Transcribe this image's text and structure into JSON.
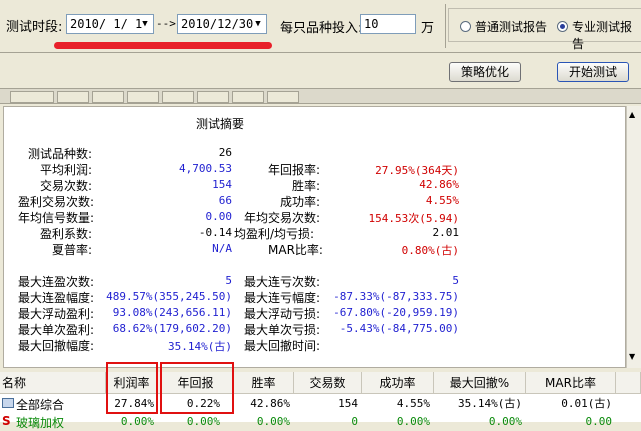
{
  "toolbar": {
    "period_label": "测试时段:",
    "start_date": "2010/ 1/ 1",
    "arrow": "-->",
    "end_date": "2010/12/30",
    "invest_label": "每只品种投入:",
    "invest_value": "10",
    "invest_unit": "万",
    "radio_normal": "普通测试报告",
    "radio_pro": "专业测试报告",
    "optimize_button": "策略优化",
    "start_button": "开始测试"
  },
  "summary": {
    "title": "测试摘要",
    "left_rows": [
      {
        "label": "测试品种数:",
        "value": "26"
      },
      {
        "label": "平均利润:",
        "value": "4,700.53"
      },
      {
        "label": "交易次数:",
        "value": "154"
      },
      {
        "label": "盈利交易次数:",
        "value": "66"
      },
      {
        "label": "年均信号数量:",
        "value": "0.00"
      },
      {
        "label": "盈利系数:",
        "value": "-0.14"
      },
      {
        "label": "夏普率:",
        "value": "N/A"
      }
    ],
    "right_rows": [
      {
        "label": "年回报率:",
        "value": "27.95%(364天)"
      },
      {
        "label": "胜率:",
        "value": "42.86%"
      },
      {
        "label": "成功率:",
        "value": "4.55%"
      },
      {
        "label": "年均交易次数:",
        "value": "154.53次(5.94)"
      },
      {
        "label": "均盈利/均亏损:",
        "value": "2.01"
      },
      {
        "label": "MAR比率:",
        "value": "0.80%(古)"
      }
    ],
    "left_rows2": [
      {
        "label": "最大连盈次数:",
        "value": "5"
      },
      {
        "label": "最大连盈幅度:",
        "value": "489.57%(355,245.50)"
      },
      {
        "label": "最大浮动盈利:",
        "value": "93.08%(243,656.11)"
      },
      {
        "label": "最大单次盈利:",
        "value": "68.62%(179,602.20)"
      },
      {
        "label": "最大回撤幅度:",
        "value": "35.14%(古)"
      }
    ],
    "right_rows2": [
      {
        "label": "最大连亏次数:",
        "value": "5"
      },
      {
        "label": "最大连亏幅度:",
        "value": "-87.33%(-87,333.75)"
      },
      {
        "label": "最大浮动亏损:",
        "value": "-67.80%(-20,959.19)"
      },
      {
        "label": "最大单次亏损:",
        "value": "-5.43%(-84,775.00)"
      },
      {
        "label": "最大回撤时间:",
        "value": ""
      }
    ]
  },
  "grid": {
    "headers": [
      "名称",
      "利润率",
      "年回报",
      "胜率",
      "交易数",
      "成功率",
      "最大回撤%",
      "MAR比率"
    ],
    "rows": [
      {
        "name": "全部综合",
        "values": [
          "27.84%",
          "0.22%",
          "42.86%",
          "154",
          "4.55%",
          "35.14%(古)",
          "0.01(古)"
        ]
      },
      {
        "name": "玻璃加权",
        "values": [
          "0.00%",
          "0.00%",
          "0.00%",
          "0",
          "0.00%",
          "0.00%",
          "0.00"
        ]
      }
    ]
  },
  "colors": {
    "annotation": "#e01010",
    "blue_value": "#1f1fd0",
    "red_value": "#d00000"
  }
}
